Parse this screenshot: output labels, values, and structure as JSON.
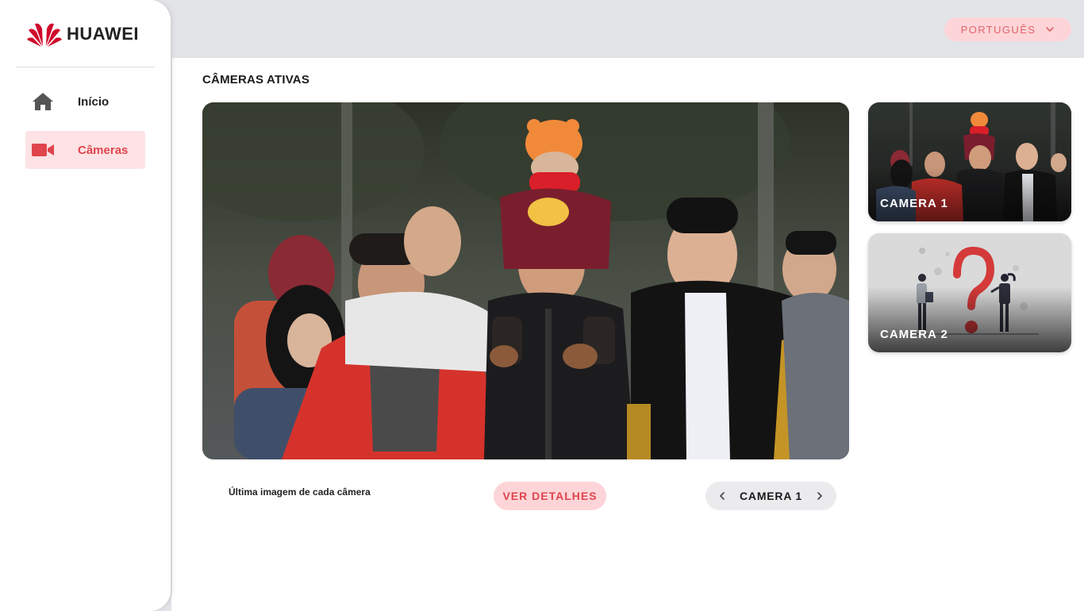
{
  "brand": {
    "name": "HUAWEI",
    "logo_icon": "huawei-flower-logo",
    "color": "#cf0a2c"
  },
  "header": {
    "language": "PORTUGUÊS",
    "language_icon": "chevron-down-icon"
  },
  "sidebar": {
    "items": [
      {
        "label": "Início",
        "icon": "home-icon",
        "active": false
      },
      {
        "label": "Câmeras",
        "icon": "video-camera-icon",
        "active": true
      }
    ]
  },
  "main": {
    "title": "CÂMERAS ATIVAS",
    "caption": "Última imagem de cada câmera",
    "details_button": "VER DETALHES",
    "selected_camera": "CAMERA 1",
    "thumbnails": [
      {
        "label": "CAMERA 1"
      },
      {
        "label": "CAMERA 2"
      }
    ]
  },
  "colors": {
    "accent": "#e0454d",
    "accent_light": "#fdd5d8",
    "topbar": "#e3e4e8"
  }
}
